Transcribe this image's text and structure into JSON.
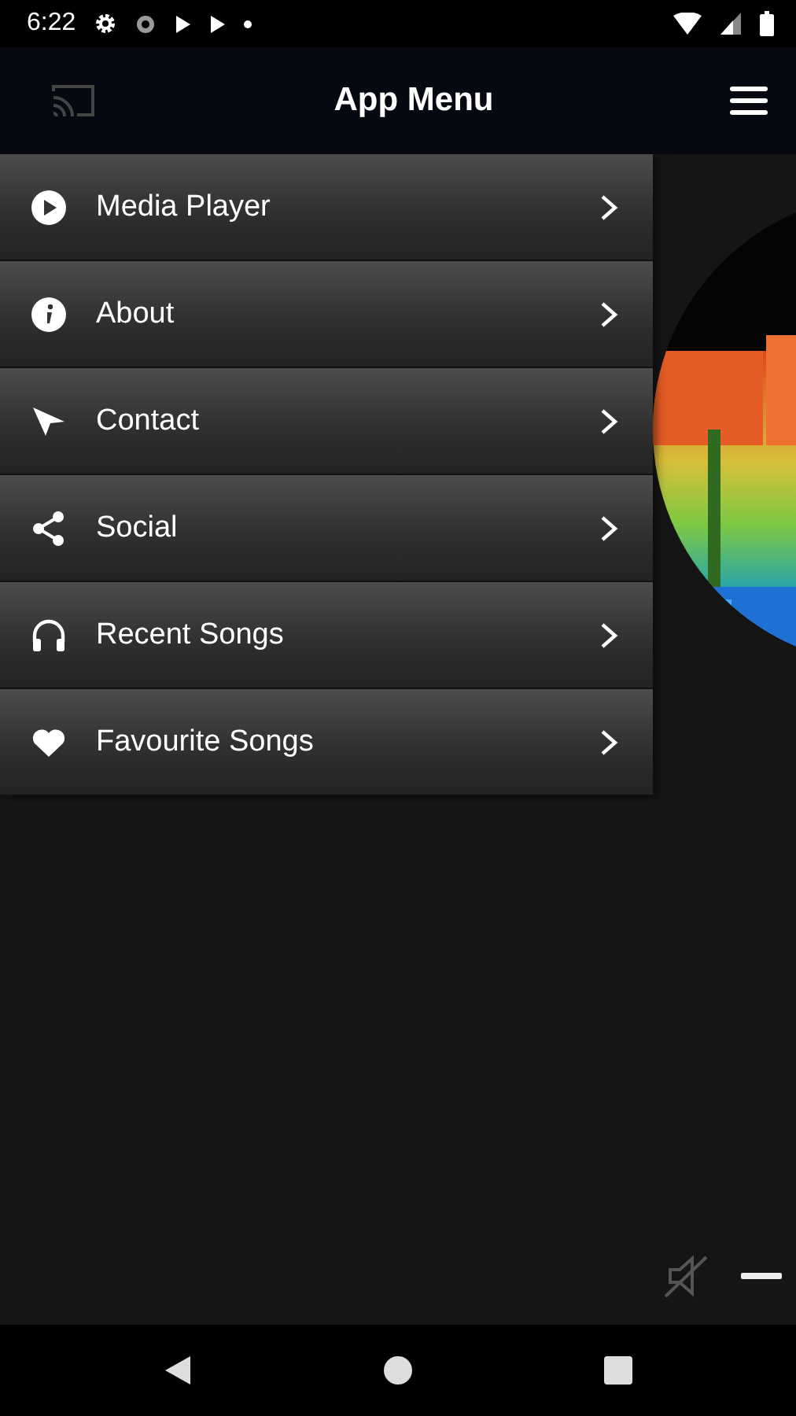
{
  "status_bar": {
    "time": "6:22"
  },
  "header": {
    "title": "App Menu"
  },
  "menu": {
    "items": [
      {
        "label": "Media Player"
      },
      {
        "label": "About"
      },
      {
        "label": "Contact"
      },
      {
        "label": "Social"
      },
      {
        "label": "Recent Songs"
      },
      {
        "label": "Favourite Songs"
      }
    ]
  },
  "player": {
    "muted": true
  }
}
